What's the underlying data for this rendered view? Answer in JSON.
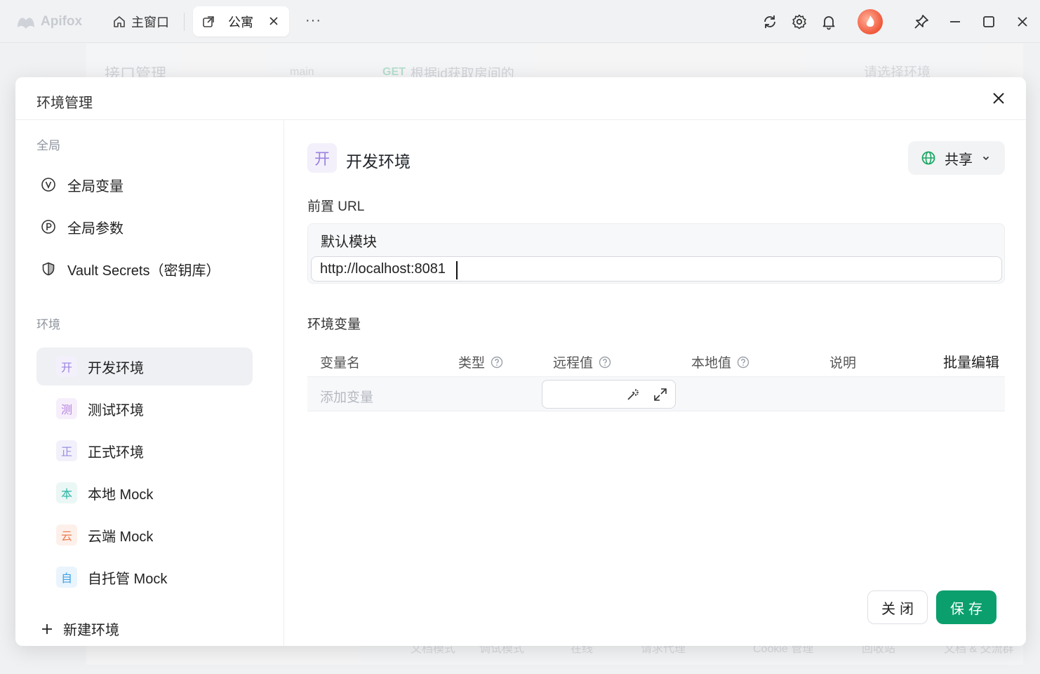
{
  "titlebar": {
    "app_name": "Apifox",
    "home_tab": "主窗口",
    "active_tab": "公寓",
    "more": "···"
  },
  "background": {
    "section": "接口管理",
    "branch": "main",
    "method": "GET",
    "endpoint": "根据id获取房间的",
    "env_placeholder": "请选择环境",
    "footer": [
      "文档模式",
      "调试模式",
      "在线",
      "请求代理",
      "Cookie 管理",
      "回收站",
      "文档 & 交流群"
    ]
  },
  "modal": {
    "title": "环境管理",
    "sidebar": {
      "global_label": "全局",
      "global_items": [
        {
          "label": "全局变量",
          "icon": "v-circle-icon"
        },
        {
          "label": "全局参数",
          "icon": "p-circle-icon"
        },
        {
          "label": "Vault Secrets（密钥库）",
          "icon": "shield-icon"
        }
      ],
      "env_label": "环境",
      "envs": [
        {
          "badge": "开",
          "label": "开发环境",
          "color": "#9b82e0",
          "bg": "#f3f0fb"
        },
        {
          "badge": "测",
          "label": "测试环境",
          "color": "#b57ee0",
          "bg": "#f6effb"
        },
        {
          "badge": "正",
          "label": "正式环境",
          "color": "#9b8fe0",
          "bg": "#f2f1fb"
        },
        {
          "badge": "本",
          "label": "本地 Mock",
          "color": "#2fb6a8",
          "bg": "#eaf7f5"
        },
        {
          "badge": "云",
          "label": "云端 Mock",
          "color": "#ee7b4e",
          "bg": "#fdf0ea"
        },
        {
          "badge": "自",
          "label": "自托管 Mock",
          "color": "#3fa1e6",
          "bg": "#eaf4fc"
        }
      ],
      "new_env": "新建环境"
    },
    "main": {
      "env_badge": "开",
      "env_name": "开发环境",
      "share": "共享",
      "url_label": "前置 URL",
      "module": "默认模块",
      "url_value": "http://localhost:8081",
      "vars_label": "环境变量",
      "columns": [
        "变量名",
        "类型",
        "远程值",
        "本地值",
        "说明"
      ],
      "bulk_edit": "批量编辑",
      "add_var_placeholder": "添加变量"
    },
    "buttons": {
      "close": "关闭",
      "save": "保存"
    }
  },
  "colors": {
    "accent": "#0b9f6e",
    "active_item_bg": "#eef0f4"
  }
}
